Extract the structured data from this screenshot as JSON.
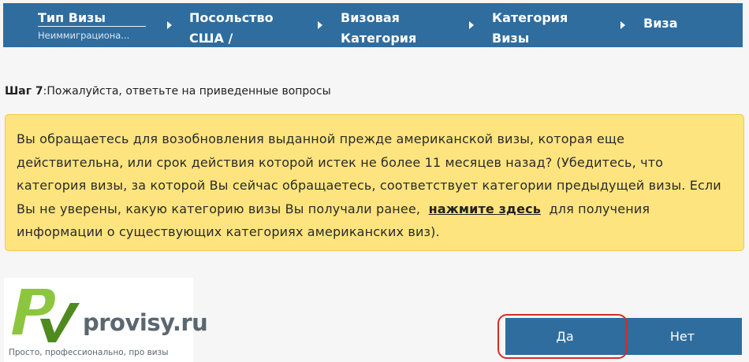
{
  "wizard": {
    "steps": [
      {
        "title": "Тип Визы",
        "sub": "Неиммиграциона..."
      },
      {
        "title": "Посольство\nСША /"
      },
      {
        "title": "Визовая\nКатегория"
      },
      {
        "title": "Категория\nВизы"
      },
      {
        "title": "Виза"
      }
    ]
  },
  "step_prompt": {
    "label": "Шаг 7",
    "text": ":Пожалуйста, ответьте на приведенные вопросы"
  },
  "notice": {
    "text_before": "Вы обращаетесь для возобновления выданной прежде американской визы, которая еще действительна, или срок действия которой истек не более 11 месяцев назад? (Убедитесь, что категория визы, за которой Вы сейчас обращаетесь, соответствует  категории предыдущей визы. Если Вы не уверены,  какую категорию визы Вы получали  ранее,",
    "link": "нажмите здесь",
    "text_after": "для получения информации о существующих категориях американских виз)."
  },
  "logo": {
    "name": "provisy.ru",
    "tagline": "Просто, профессионально, про визы"
  },
  "buttons": {
    "yes": "Да",
    "no": "Нет"
  },
  "colors": {
    "nav_bg": "#2f6d9f",
    "notice_bg": "#fde47e",
    "highlight": "#d32c2c"
  }
}
